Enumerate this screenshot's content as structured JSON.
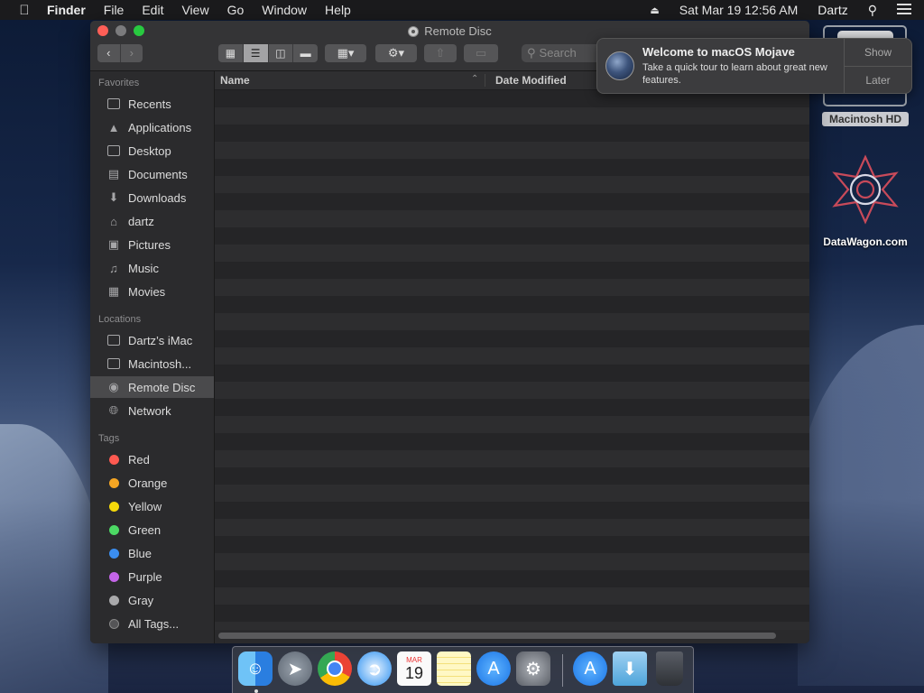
{
  "menubar": {
    "app_name": "Finder",
    "menus": [
      "File",
      "Edit",
      "View",
      "Go",
      "Window",
      "Help"
    ],
    "datetime": "Sat Mar 19  12:56 AM",
    "user": "Dartz"
  },
  "window": {
    "title": "Remote Disc",
    "search_placeholder": "Search",
    "columns": {
      "name": "Name",
      "date_modified": "Date Modified"
    }
  },
  "sidebar": {
    "favorites_header": "Favorites",
    "favorites": [
      "Recents",
      "Applications",
      "Desktop",
      "Documents",
      "Downloads",
      "dartz",
      "Pictures",
      "Music",
      "Movies"
    ],
    "locations_header": "Locations",
    "locations": [
      "Dartz’s iMac",
      "Macintosh...",
      "Remote Disc",
      "Network"
    ],
    "tags_header": "Tags",
    "tags": [
      "Red",
      "Orange",
      "Yellow",
      "Green",
      "Blue",
      "Purple",
      "Gray",
      "All Tags..."
    ],
    "tag_colors": [
      "#fe5a51",
      "#f6a623",
      "#f5d90a",
      "#4cd964",
      "#3b8ef0",
      "#c465e8",
      "#a9a9ab",
      "#555557"
    ],
    "selected": "Remote Disc"
  },
  "notification": {
    "title": "Welcome to macOS Mojave",
    "body": "Take a quick tour to learn about great new features.",
    "show_label": "Show",
    "later_label": "Later"
  },
  "desktop": {
    "hd_label": "Macintosh HD",
    "datawagon_label": "DataWagon.com"
  },
  "dock": {
    "calendar_month": "MAR",
    "calendar_day": "19"
  }
}
